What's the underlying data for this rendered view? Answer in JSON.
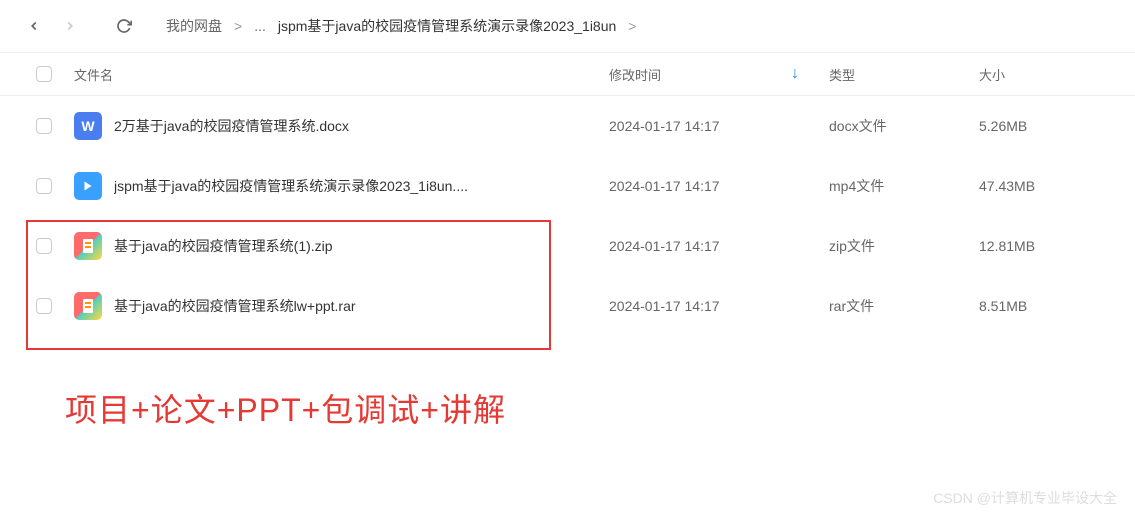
{
  "toolbar": {
    "breadcrumb": {
      "root": "我的网盘",
      "ellipsis": "...",
      "current": "jspm基于java的校园疫情管理系统演示录像2023_1i8un"
    }
  },
  "columns": {
    "name": "文件名",
    "mtime": "修改时间",
    "type": "类型",
    "size": "大小"
  },
  "files": [
    {
      "icon": "docx",
      "icon_glyph": "W",
      "name": "2万基于java的校园疫情管理系统.docx",
      "mtime": "2024-01-17 14:17",
      "type": "docx文件",
      "size": "5.26MB"
    },
    {
      "icon": "mp4",
      "icon_glyph": "▶",
      "name": "jspm基于java的校园疫情管理系统演示录像2023_1i8un....",
      "mtime": "2024-01-17 14:17",
      "type": "mp4文件",
      "size": "47.43MB"
    },
    {
      "icon": "zip",
      "icon_glyph": "",
      "name": "基于java的校园疫情管理系统(1).zip",
      "mtime": "2024-01-17 14:17",
      "type": "zip文件",
      "size": "12.81MB"
    },
    {
      "icon": "rar",
      "icon_glyph": "",
      "name": "基于java的校园疫情管理系统lw+ppt.rar",
      "mtime": "2024-01-17 14:17",
      "type": "rar文件",
      "size": "8.51MB"
    }
  ],
  "annotation": "项目+论文+PPT+包调试+讲解",
  "watermark": "CSDN @计算机专业毕设大全"
}
